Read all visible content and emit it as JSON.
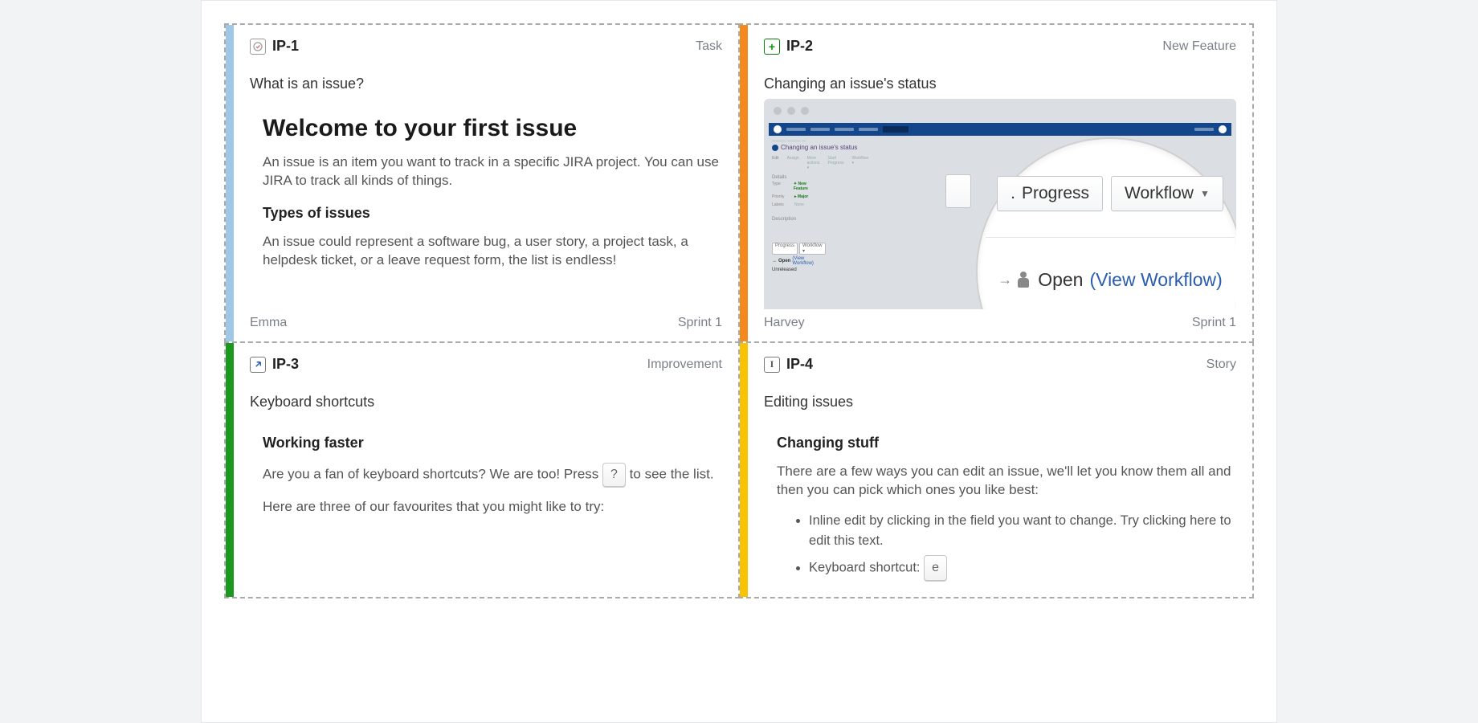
{
  "cards": [
    {
      "key": "IP-1",
      "type": "Task",
      "title": "What is an issue?",
      "assignee": "Emma",
      "sprint": "Sprint 1",
      "body": {
        "h1": "Welcome to your first issue",
        "p1": "An issue is an item you want to track in a specific JIRA project. You can use JIRA to track all kinds of things.",
        "h2": "Types of issues",
        "p2": "An issue could represent a software bug, a user story, a project task, a helpdesk ticket, or a leave request form, the list is endless!"
      }
    },
    {
      "key": "IP-2",
      "type": "New Feature",
      "title": "Changing an issue's status",
      "assignee": "Harvey",
      "sprint": "Sprint 1",
      "illus": {
        "btn_progress": "Progress",
        "btn_workflow": "Workflow",
        "status": "Open",
        "view_link": "View Workflow"
      }
    },
    {
      "key": "IP-3",
      "type": "Improvement",
      "title": "Keyboard shortcuts",
      "body": {
        "h2": "Working faster",
        "p1_a": "Are you a fan of keyboard shortcuts? We are too! Press ",
        "kbd": "?",
        "p1_b": " to see the list.",
        "p2": "Here are three of our favourites that you might like to try:"
      }
    },
    {
      "key": "IP-4",
      "type": "Story",
      "title": "Editing issues",
      "body": {
        "h2": "Changing stuff",
        "p1": "There are a few ways you can edit an issue, we'll let you know them all and then you can pick which ones you like best:",
        "li1": "Inline edit by clicking in the field you want to change. Try clicking here to edit this text.",
        "li2_a": "Keyboard shortcut: ",
        "li2_kbd": "e"
      }
    }
  ]
}
